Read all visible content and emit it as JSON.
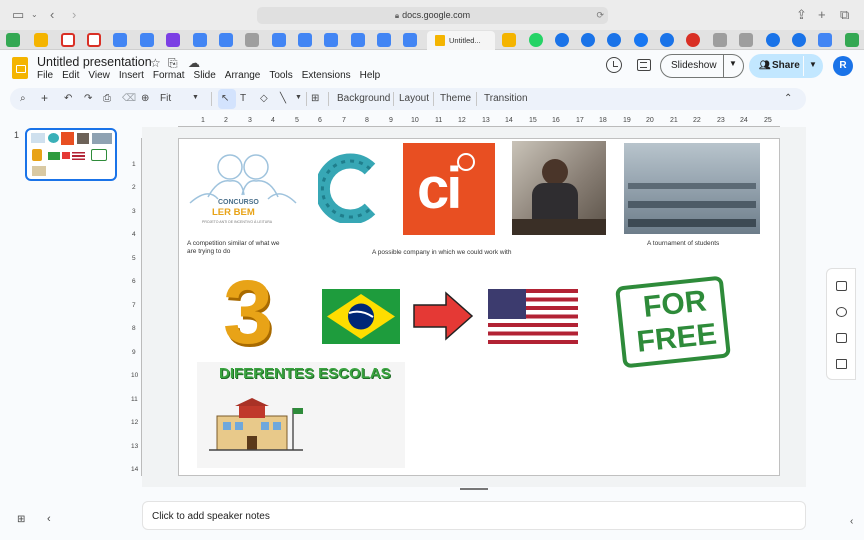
{
  "browser": {
    "url": "docs.google.com",
    "active_tab_title": "Untitled..."
  },
  "header": {
    "doc_title": "Untitled presentation",
    "menu": [
      "File",
      "Edit",
      "View",
      "Insert",
      "Format",
      "Slide",
      "Arrange",
      "Tools",
      "Extensions",
      "Help"
    ],
    "slideshow_label": "Slideshow",
    "share_label": "Share",
    "avatar_initial": "R"
  },
  "toolbar": {
    "zoom": "Fit",
    "background_label": "Background",
    "layout_label": "Layout",
    "theme_label": "Theme",
    "transition_label": "Transition"
  },
  "filmstrip": {
    "slide_number": "1"
  },
  "ruler": {
    "h_ticks": [
      "1",
      "2",
      "3",
      "4",
      "5",
      "6",
      "7",
      "8",
      "9",
      "10",
      "11",
      "12",
      "13",
      "14",
      "15",
      "16",
      "17",
      "18",
      "19",
      "20",
      "21",
      "22",
      "23",
      "24",
      "25"
    ],
    "v_ticks": [
      "1",
      "2",
      "3",
      "4",
      "5",
      "6",
      "7",
      "8",
      "9",
      "10",
      "11",
      "12",
      "13",
      "14"
    ]
  },
  "slide": {
    "logo_lines": [
      "CONCURSO",
      "LER BEM",
      "PROJETO ANTI DE INCENTIVO À LEITURA"
    ],
    "ci_text": "ci",
    "caption_competition": "A competition similar of what we are trying to do",
    "caption_company": "A possible company in which we could work with",
    "caption_tournament": "A tournament of students",
    "number_three": "3",
    "for_free_text": [
      "FOR",
      "FREE"
    ],
    "schools_title": "DIFERENTES ESCOLAS"
  },
  "notes": {
    "placeholder": "Click to add speaker notes"
  },
  "colors": {
    "accent": "#1a73e8",
    "share_bg": "#c2e7ff",
    "slides_yellow": "#f4b400",
    "ci_orange": "#e84f22",
    "for_free_green": "#2e8b3a",
    "schools_green": "#3aa340"
  }
}
